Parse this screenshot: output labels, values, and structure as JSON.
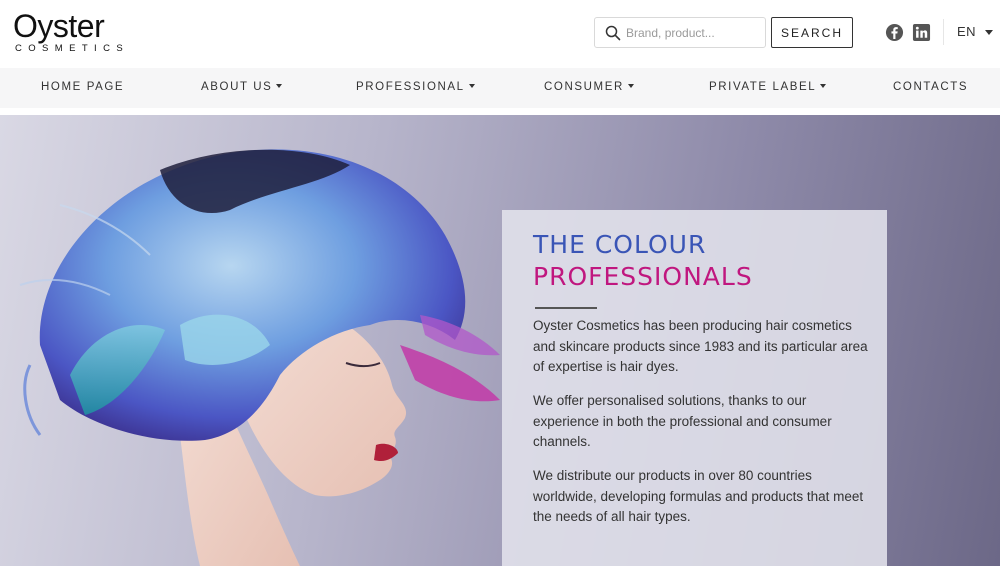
{
  "brand": {
    "name": "Oyster",
    "tagline": "COSMETICS"
  },
  "search": {
    "placeholder": "Brand, product...",
    "button_label": "SEARCH"
  },
  "social": {
    "facebook_icon": "facebook-icon",
    "linkedin_icon": "linkedin-icon"
  },
  "language": {
    "selected": "EN"
  },
  "nav": {
    "items": [
      {
        "label": "HOME PAGE",
        "dropdown": false
      },
      {
        "label": "ABOUT US",
        "dropdown": true
      },
      {
        "label": "PROFESSIONAL",
        "dropdown": true
      },
      {
        "label": "CONSUMER",
        "dropdown": true
      },
      {
        "label": "PRIVATE LABEL",
        "dropdown": true
      },
      {
        "label": "CONTACTS",
        "dropdown": false
      }
    ]
  },
  "hero": {
    "title_line1": "THE COLOUR",
    "title_line2": "PROFESSIONALS",
    "paragraphs": [
      "Oyster Cosmetics has been producing hair cosmetics and skincare products since 1983 and its particular area of expertise is hair dyes.",
      "We offer personalised solutions, thanks to our experience in both the professional and consumer channels.",
      "We distribute our products in over 80 countries worldwide, developing formulas and products that meet the needs of all hair types."
    ]
  },
  "colors": {
    "title_blue": "#3a55b6",
    "title_magenta": "#c0177f",
    "nav_bg": "#f6f6f7",
    "text": "#333333"
  }
}
